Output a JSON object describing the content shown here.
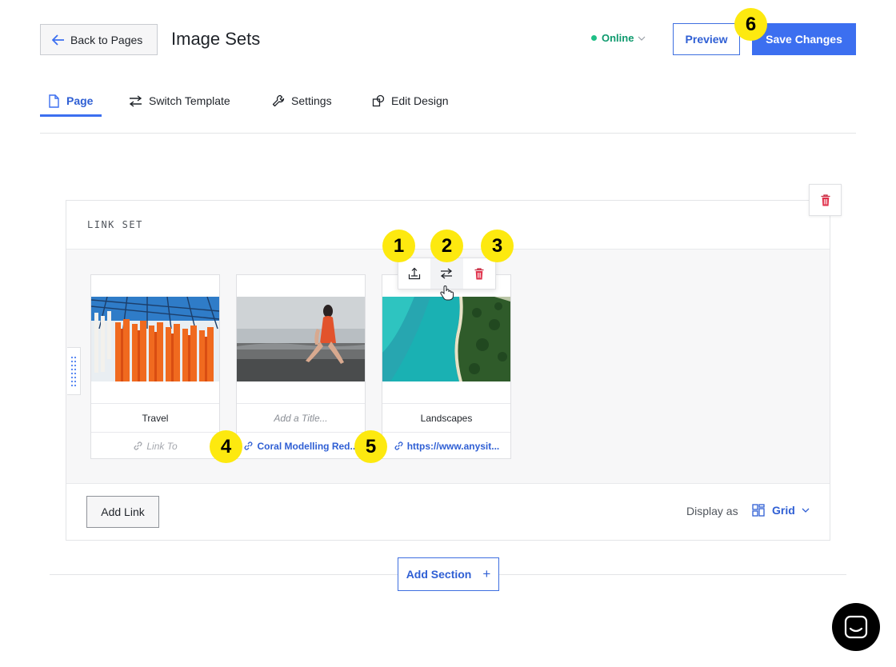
{
  "header": {
    "back_label": "Back to Pages",
    "title": "Image Sets",
    "status": "Online",
    "preview_label": "Preview",
    "save_label": "Save Changes"
  },
  "tabs": [
    {
      "label": "Page",
      "active": true
    },
    {
      "label": "Switch Template"
    },
    {
      "label": "Settings"
    },
    {
      "label": "Edit Design"
    }
  ],
  "section": {
    "label": "LINK SET",
    "cards": [
      {
        "title": "Travel",
        "title_is_placeholder": false,
        "link": "Link To",
        "link_is_placeholder": true
      },
      {
        "title": "Add a Title...",
        "title_is_placeholder": true,
        "link": "Coral Modelling Red...",
        "link_is_placeholder": false
      },
      {
        "title": "Landscapes",
        "title_is_placeholder": false,
        "link": "https://www.anysit...",
        "link_is_placeholder": false
      }
    ],
    "add_link_label": "Add Link",
    "display_as_label": "Display as",
    "display_mode": "Grid"
  },
  "add_section_label": "Add Section",
  "markers": [
    "1",
    "2",
    "3",
    "4",
    "5",
    "6"
  ],
  "colors": {
    "accent": "#3c6ff0",
    "online": "#0f9a6e",
    "danger": "#e0314b",
    "marker": "#fde90f"
  }
}
